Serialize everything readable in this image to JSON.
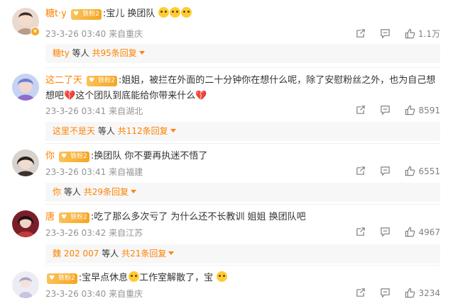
{
  "comments": [
    {
      "username": "糖t·y",
      "badge": "铁粉2",
      "text": ":宝儿  换团队",
      "emoji_count": 3,
      "time": "23-3-26 03:40",
      "location": "来自重庆",
      "likes": "1.1万",
      "reply_user": "糖ty",
      "reply_middle": "等人",
      "reply_count": "共95条回复"
    },
    {
      "username": "这二了天",
      "badge": "铁粉2",
      "text_a": ":姐姐，被拦在外面的二十分钟你在想什么呢，除了安慰粉丝之外，也为自己想想吧",
      "text_b": "这个团队到底能给你带来什么",
      "time": "23-3-26 03:41",
      "location": "来自湖北",
      "likes": "8591",
      "reply_user": "这里不是天",
      "reply_middle": "等人",
      "reply_count": "共112条回复"
    },
    {
      "username": "你",
      "badge": "铁粉2",
      "text": ":换团队  你不要再执迷不悟了",
      "time": "23-3-26 03:41",
      "location": "来自福建",
      "likes": "6551",
      "reply_user": "你",
      "reply_middle": "等人",
      "reply_count": "共29条回复"
    },
    {
      "username": "唐",
      "badge": "铁粉2",
      "text": ":吃了那么多次亏了  为什么还不长教训  姐姐  换团队吧",
      "time": "23-3-26 03:42",
      "location": "来自江苏",
      "likes": "4967",
      "reply_user": "魏 202 007",
      "reply_middle": "等人",
      "reply_count": "共21条回复"
    },
    {
      "username": "",
      "badge": "铁粉2",
      "text_a": ":宝早点休息",
      "text_b": "工作室解散了，宝",
      "time": "23-3-26 03:40",
      "location": "来自重庆",
      "likes": "3234"
    }
  ],
  "colors": {
    "accent": "#ff8200",
    "meta": "#939393",
    "reply_bg": "#f7f7f7",
    "badge": "#f5a623"
  },
  "icons": [
    "share-icon",
    "comment-icon",
    "like-icon",
    "chevron-down-icon"
  ]
}
